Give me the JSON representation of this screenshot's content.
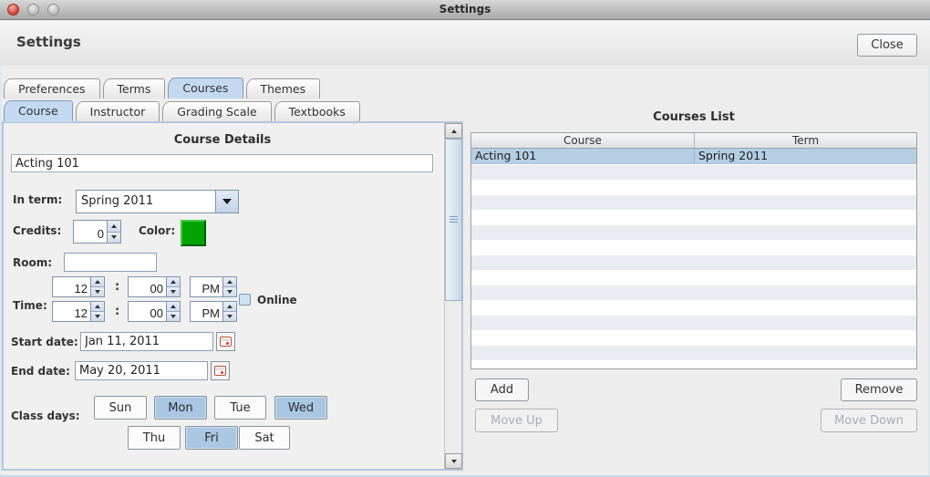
{
  "window": {
    "title": "Settings"
  },
  "header": {
    "title": "Settings",
    "close_label": "Close"
  },
  "tabs": {
    "main": [
      {
        "label": "Preferences",
        "selected": false
      },
      {
        "label": "Terms",
        "selected": false
      },
      {
        "label": "Courses",
        "selected": true
      },
      {
        "label": "Themes",
        "selected": false
      }
    ],
    "sub": [
      {
        "label": "Course",
        "selected": true
      },
      {
        "label": "Instructor",
        "selected": false
      },
      {
        "label": "Grading Scale",
        "selected": false
      },
      {
        "label": "Textbooks",
        "selected": false
      }
    ]
  },
  "course_form": {
    "title": "Course Details",
    "name_value": "Acting 101",
    "in_term": {
      "label": "In term:",
      "value": "Spring 2011"
    },
    "credits": {
      "label": "Credits:",
      "value": "0"
    },
    "color": {
      "label": "Color:",
      "swatch_hex": "#00a300"
    },
    "room": {
      "label": "Room:",
      "value": ""
    },
    "time": {
      "label": "Time:",
      "separator": ":",
      "start": {
        "hour": "12",
        "minute": "00",
        "ampm": "PM"
      },
      "end": {
        "hour": "12",
        "minute": "00",
        "ampm": "PM"
      }
    },
    "online": {
      "label": "Online",
      "checked": false
    },
    "start_date": {
      "label": "Start date:",
      "value": "Jan 11, 2011"
    },
    "end_date": {
      "label": "End date:",
      "value": "May 20, 2011"
    },
    "class_days": {
      "label": "Class days:",
      "days": [
        {
          "label": "Sun",
          "selected": false
        },
        {
          "label": "Mon",
          "selected": true
        },
        {
          "label": "Tue",
          "selected": false
        },
        {
          "label": "Wed",
          "selected": true
        },
        {
          "label": "Thu",
          "selected": false
        },
        {
          "label": "Fri",
          "selected": true
        },
        {
          "label": "Sat",
          "selected": false
        }
      ]
    }
  },
  "courses_list": {
    "title": "Courses List",
    "columns": [
      "Course",
      "Term"
    ],
    "rows": [
      {
        "course": "Acting 101",
        "term": "Spring 2011",
        "selected": true
      }
    ],
    "buttons": {
      "add": "Add",
      "remove": "Remove",
      "move_up": "Move Up",
      "move_down": "Move Down",
      "move_up_enabled": false,
      "move_down_enabled": false
    }
  },
  "colors": {
    "selection_blue": "#b5cee4",
    "tab_selected_blue": "#c4d9f0",
    "course_color_swatch": "#00a300"
  }
}
